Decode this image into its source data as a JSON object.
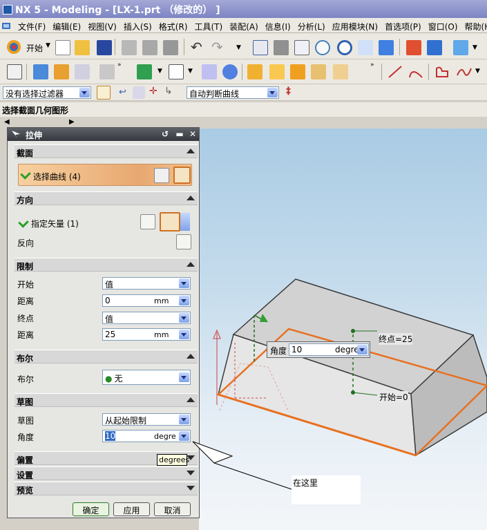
{
  "window": {
    "title": "NX 5 - Modeling - [LX-1.prt （修改的） ]"
  },
  "menu": {
    "items": [
      "文件(F)",
      "编辑(E)",
      "视图(V)",
      "插入(S)",
      "格式(R)",
      "工具(T)",
      "装配(A)",
      "信息(I)",
      "分析(L)",
      "应用模块(N)",
      "首选项(P)",
      "窗口(O)",
      "帮助(H)"
    ]
  },
  "toolbar": {
    "start_label": "开始"
  },
  "filters": {
    "selection_filter": "没有选择过滤器",
    "curve_rule": "自动判断曲线"
  },
  "cue_line": "选择截面几何图形",
  "dialog": {
    "title": "拉伸",
    "sections": {
      "section": {
        "header": "截面",
        "select_curve": "选择曲线 (4)"
      },
      "direction": {
        "header": "方向",
        "specify_vector": "指定矢量 (1)",
        "reverse": "反向"
      },
      "limits": {
        "header": "限制",
        "start_label": "开始",
        "start_value": "值",
        "start_distance_label": "距离",
        "start_distance": "0",
        "start_unit": "mm",
        "end_label": "终点",
        "end_value": "值",
        "end_distance_label": "距离",
        "end_distance": "25",
        "end_unit": "mm"
      },
      "boolean": {
        "header": "布尔",
        "label": "布尔",
        "value": "无"
      },
      "draft": {
        "header": "草图",
        "label": "草图",
        "value": "从起始限制",
        "angle_label": "角度",
        "angle_value": "10",
        "angle_unit": "degre"
      },
      "offset": {
        "header": "偏置"
      },
      "settings": {
        "header": "设置"
      },
      "preview": {
        "header": "预览"
      }
    },
    "buttons": {
      "ok": "确定",
      "apply": "应用",
      "cancel": "取消"
    }
  },
  "tooltip": "degrees",
  "viewport": {
    "angle_label": "角度",
    "angle_value": "10",
    "angle_unit": "degre",
    "end_label": "终点=25",
    "start_label": "开始=0"
  },
  "annotation": "在这里"
}
